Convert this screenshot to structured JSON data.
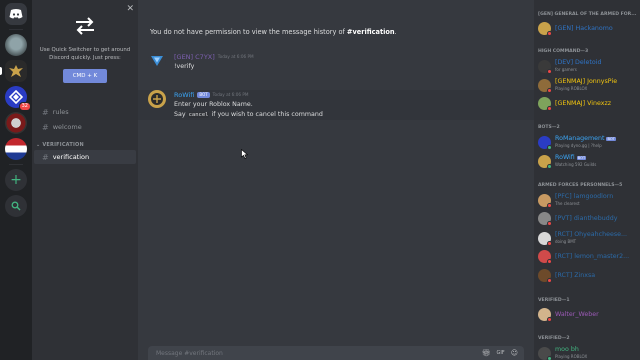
{
  "servers": [
    {
      "name": "home",
      "badge": ""
    },
    {
      "name": "server-1",
      "badge": ""
    },
    {
      "name": "server-2",
      "badge": ""
    },
    {
      "name": "server-3",
      "badge": "32"
    },
    {
      "name": "server-4",
      "badge": ""
    },
    {
      "name": "server-5",
      "badge": ""
    }
  ],
  "quick_switcher": {
    "text": "Use Quick Switcher to get around Discord quickly. Just press:",
    "shortcut": "CMD + K"
  },
  "channels": {
    "items": [
      {
        "label": "rules"
      },
      {
        "label": "welcome"
      }
    ],
    "category": "VERIFICATION",
    "category_items": [
      {
        "label": "verification"
      }
    ]
  },
  "chat": {
    "no_permission_prefix": "You do not have permission to view the message history of ",
    "no_permission_channel": "#verification",
    "no_permission_suffix": ".",
    "messages": [
      {
        "author": "[GEN] C7YX]",
        "timestamp": "Today at 6:06 PM",
        "text": "!verify",
        "author_color": "#7d5fb0"
      },
      {
        "author": "RoWifi",
        "bot_tag": "BOT",
        "timestamp": "Today at 6:06 PM",
        "line1": "Enter your Roblox Name.",
        "line2_pre": "Say ",
        "line2_code": "cancel",
        "line2_post": " if you wish to cancel this command",
        "author_color": "#3ba5f5"
      }
    ],
    "input_placeholder": "Message #verification"
  },
  "members": {
    "cat_general": "[GEN] GENERAL OF THE ARMED FOR...",
    "general": [
      {
        "name": "[GEN] Hackanomo",
        "activity": "",
        "color": "#2f73c4"
      }
    ],
    "cat_high": "HIGH COMMAND—3",
    "high": [
      {
        "name": "[DEV] Deletoid",
        "activity": "for gamers",
        "color": "#2f73c4"
      },
      {
        "name": "[GENMAJ] JonnysPie",
        "activity": "Playing ROBLOX",
        "color": "#f1c40f"
      },
      {
        "name": "[GENMAJ] Vinexzz",
        "activity": "",
        "color": "#f1c40f"
      }
    ],
    "cat_bots": "BOTS—2",
    "bots": [
      {
        "name": "RoManagement",
        "tag": "BOT",
        "activity": "Playing dyno.gg | ?help",
        "color": "#3ba5f5"
      },
      {
        "name": "RoWifi",
        "tag": "BOT",
        "activity": "Watching 592 Guilds",
        "color": "#3ba5f5"
      }
    ],
    "cat_armed": "ARMED FORCES PERSONNELS—5",
    "armed": [
      {
        "name": "[PFC] lamgoodlorn",
        "activity": "The clearest",
        "color": "#2b6aa8"
      },
      {
        "name": "[PVT] dianthebuddy",
        "activity": "",
        "color": "#2b6aa8"
      },
      {
        "name": "[RCT] Ohyeahcheese...",
        "activity": "doing BMT",
        "color": "#2b6aa8"
      },
      {
        "name": "[RCT] lemon_master2...",
        "activity": "",
        "color": "#2b6aa8"
      },
      {
        "name": "[RCT] Zinxsa",
        "activity": "",
        "color": "#2b6aa8"
      }
    ],
    "cat_verified": "VERIFIED—1",
    "verified": [
      {
        "name": "Walter_Weber",
        "activity": "",
        "color": "#9b59b6"
      }
    ],
    "cat_verified2": "VERIFIED—2",
    "verified2": [
      {
        "name": "moo bh",
        "activity": "Playing ROBLOX",
        "color": "#43b581"
      }
    ]
  }
}
